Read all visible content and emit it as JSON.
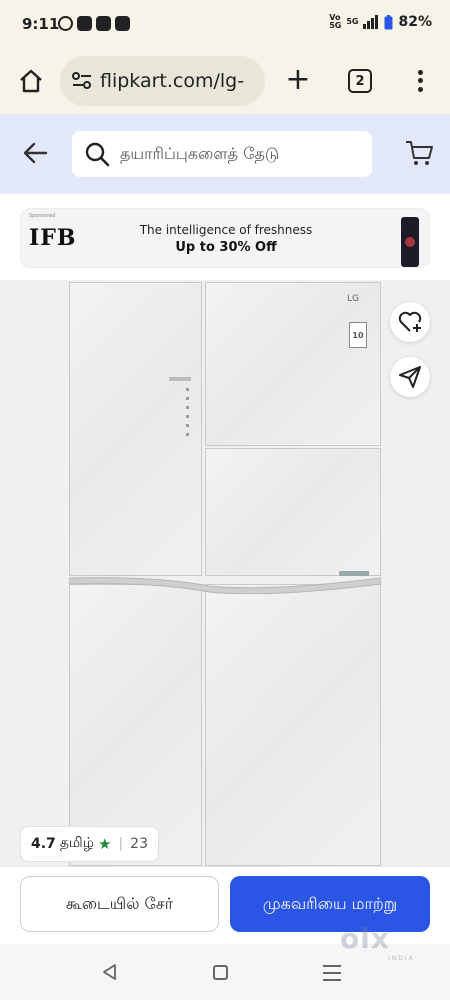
{
  "status_bar": {
    "time": "9:11",
    "network": "5G",
    "battery": "82%"
  },
  "browser": {
    "url": "flipkart.com/lg-",
    "tab_count": "2"
  },
  "header": {
    "search_placeholder": "தயாரிப்புகளைத் தேடு"
  },
  "ad": {
    "sponsored": "Sponsored",
    "brand": "IFB",
    "line1": "The intelligence of freshness",
    "line2": "Up to 30% Off"
  },
  "product": {
    "brand_mark": "LG",
    "energy_rating": "10"
  },
  "rating": {
    "value": "4.7",
    "language": "தமிழ்",
    "star": "★",
    "count": "23"
  },
  "actions": {
    "add_to_cart": "கூடையில் சேர்",
    "change_address": "முகவரியை மாற்று"
  },
  "watermark": {
    "brand": "olx",
    "region": "INDIA"
  },
  "colors": {
    "primary_button": "#2a55e5",
    "header_bg": "#e4e8fb",
    "rating_star": "#1e8a3c"
  },
  "icons": [
    "home-icon",
    "site-settings-icon",
    "plus-icon",
    "tabs-icon",
    "more-vert-icon",
    "back-arrow-icon",
    "search-icon",
    "cart-icon",
    "wishlist-heart-icon",
    "share-icon"
  ]
}
